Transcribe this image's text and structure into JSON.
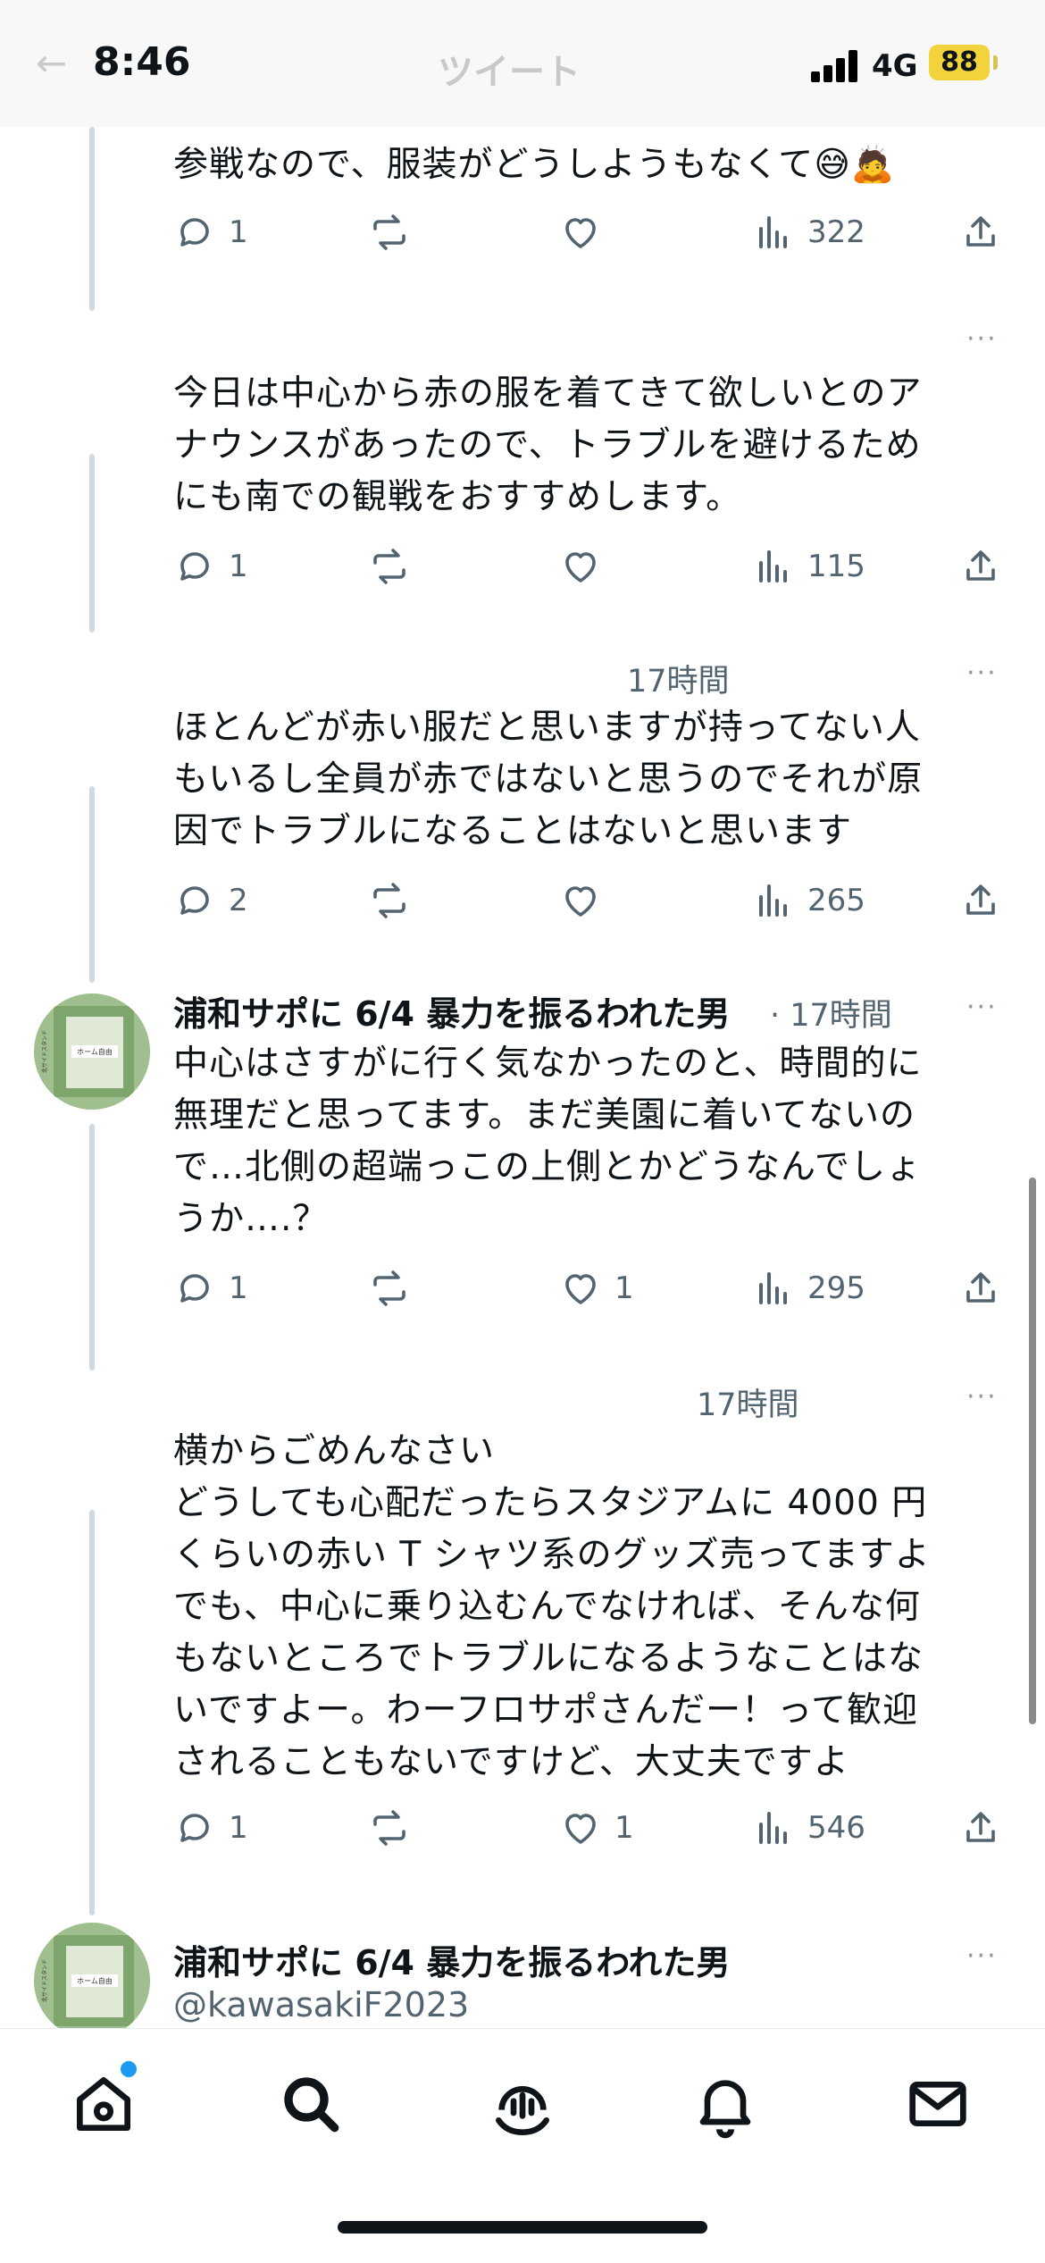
{
  "status": {
    "time": "8:46",
    "network": "4G",
    "battery": "88",
    "nav_title": "ツイート"
  },
  "tweets": [
    {
      "text": "参戦なので、服装がどうしようもなくて😅🙇",
      "replies": "1",
      "retweets": "",
      "likes": "",
      "views": "322"
    },
    {
      "text": "今日は中心から赤の服を着てきて欲しいとのア\nナウンスがあったので、トラブルを避けるため\nにも南での観戦をおすすめします。",
      "replies": "1",
      "retweets": "",
      "likes": "",
      "views": "115"
    },
    {
      "time": "17時間",
      "text": "ほとんどが赤い服だと思いますが持ってない人\nもいるし全員が赤ではないと思うのでそれが原\n因でトラブルになることはないと思います",
      "replies": "2",
      "retweets": "",
      "likes": "",
      "views": "265"
    },
    {
      "name": "浦和サポに 6/4 暴力を振るわれた男",
      "time": "· 17時間",
      "text": "中心はさすがに行く気なかったのと、時間的に\n無理だと思ってます。まだ美園に着いてないの\nで…北側の超端っこの上側とかどうなんでしょ\nうか….？",
      "replies": "1",
      "retweets": "",
      "likes": "1",
      "views": "295"
    },
    {
      "time": "17時間",
      "text": "横からごめんなさい\nどうしても心配だったらスタジアムに 4000 円\nくらいの赤い T シャツ系のグッズ売ってますよ\nでも、中心に乗り込むんでなければ、そんな何\nもないところでトラブルになるようなことはな\nいですよー。わーフロサポさんだー！って歓迎\nされることもないですけど、大丈夫ですよ",
      "replies": "1",
      "retweets": "",
      "likes": "1",
      "views": "546"
    },
    {
      "name": "浦和サポに 6/4 暴力を振るわれた男",
      "handle": "@kawasakiF2023"
    }
  ],
  "avatar_label": "ホーム自由",
  "avatar_side_label": "北サイドスタンド",
  "more_label": "···",
  "tabbar": {
    "icons": [
      "home-icon",
      "search-icon",
      "spaces-icon",
      "notifications-icon",
      "messages-icon"
    ]
  }
}
